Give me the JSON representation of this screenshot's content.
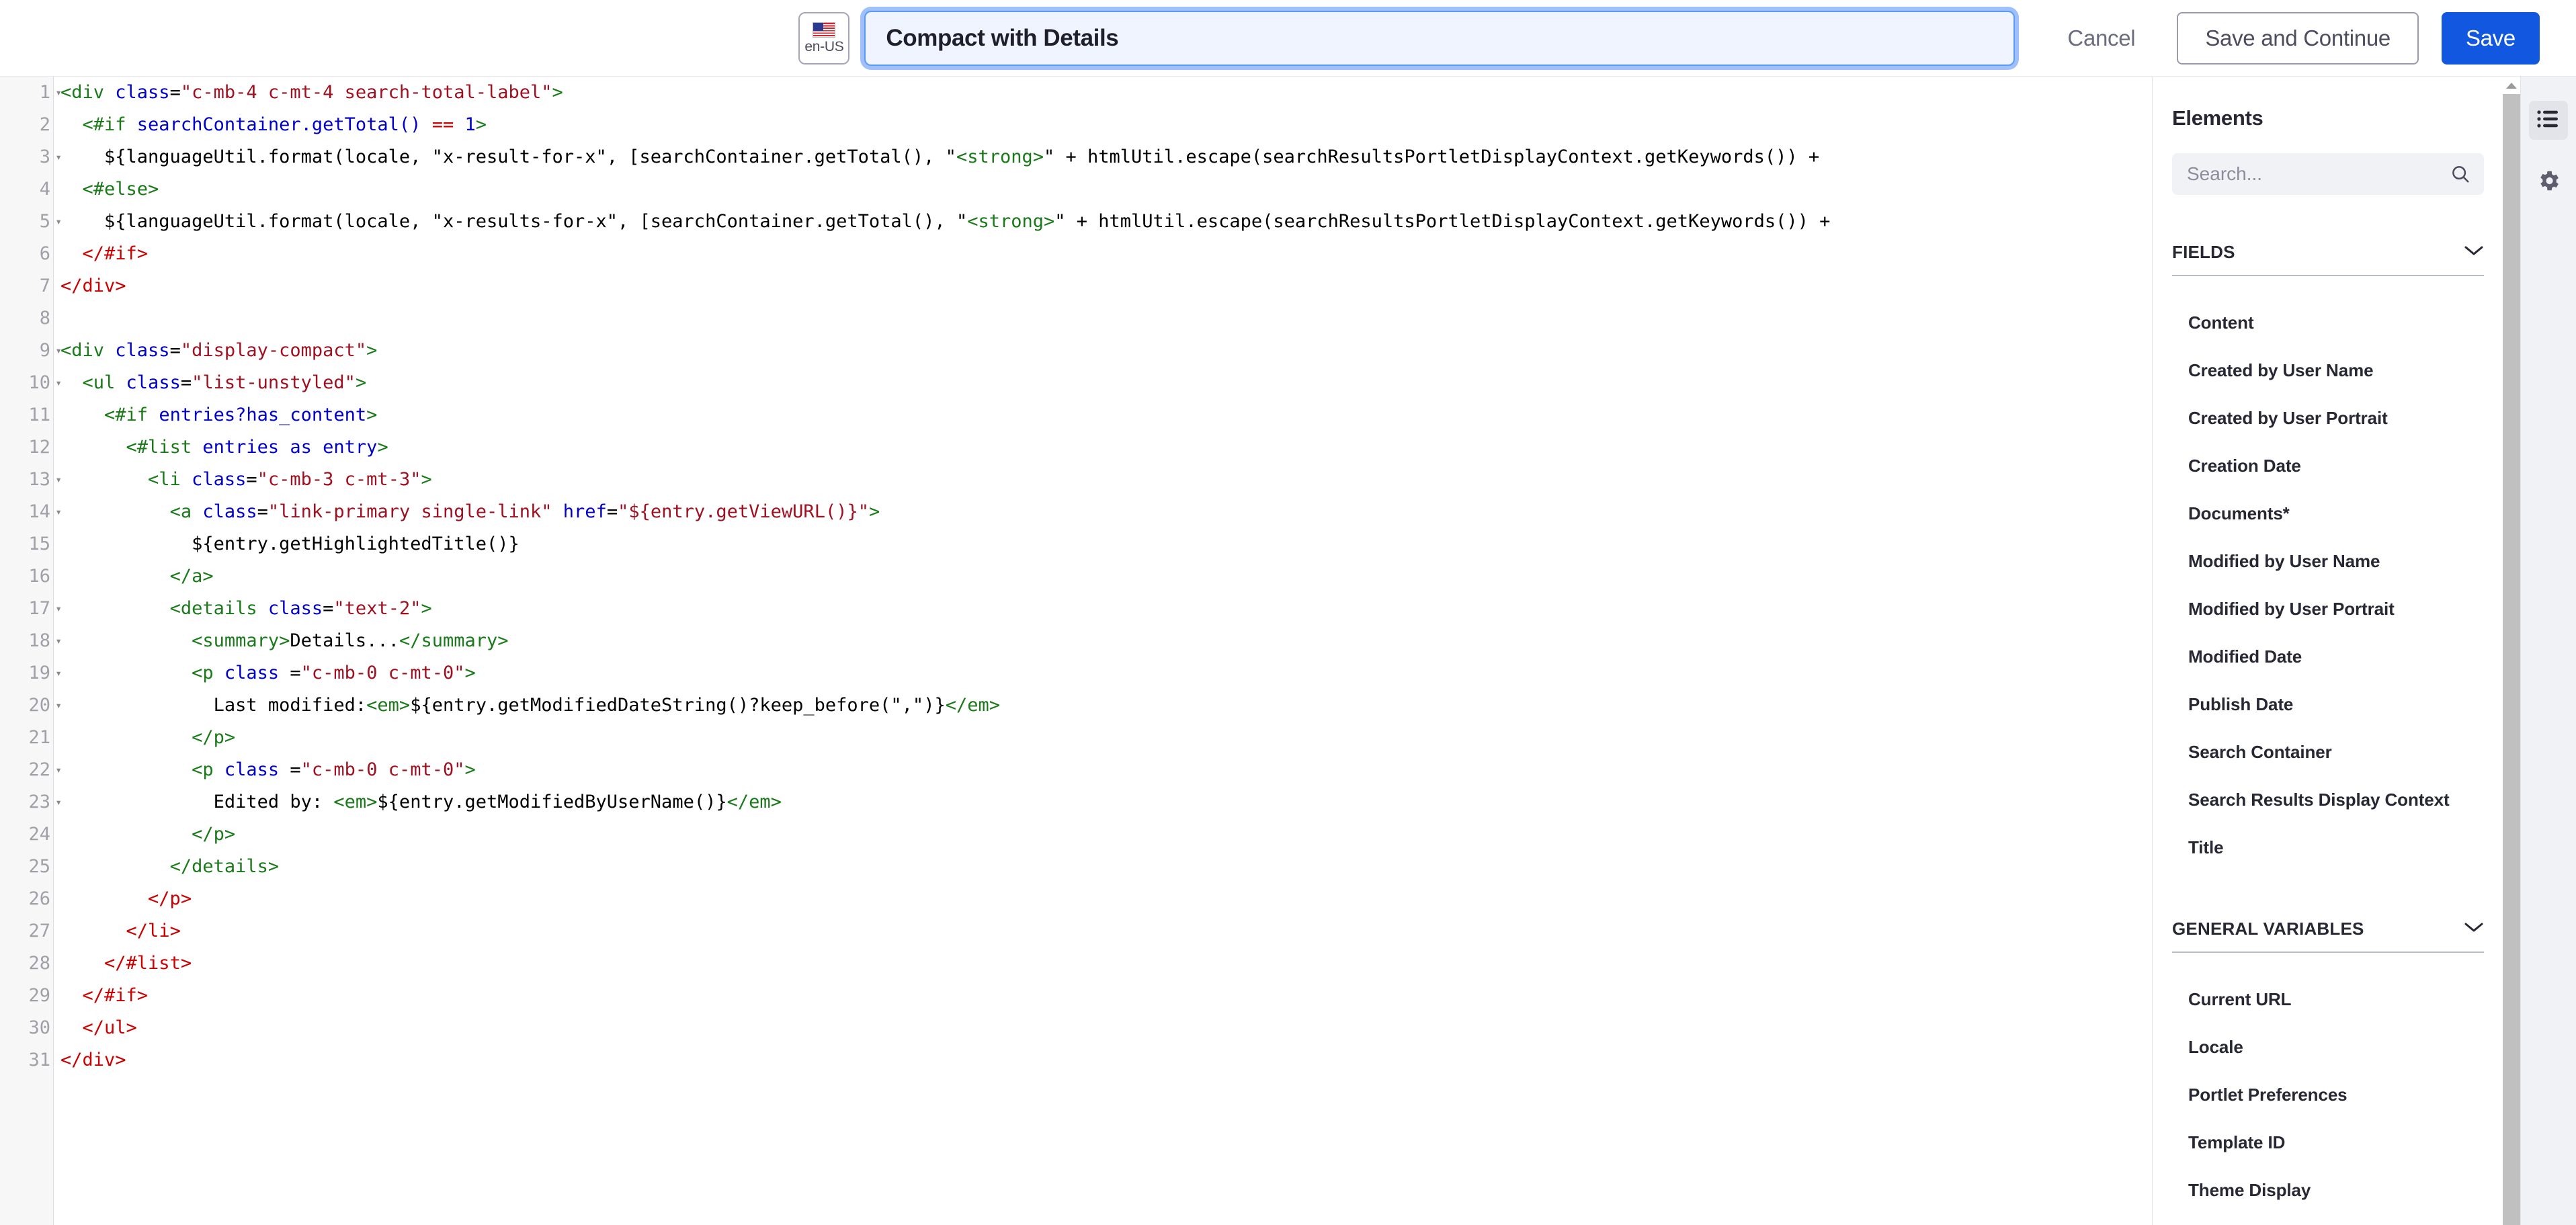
{
  "topbar": {
    "locale": {
      "code": "en-US",
      "flag_icon": "us-flag-icon"
    },
    "title_value": "Compact with Details",
    "title_placeholder": "Untitled Template",
    "cancel_label": "Cancel",
    "save_continue_label": "Save and Continue",
    "save_label": "Save",
    "accent_color": "#1257e0",
    "focus_border_color": "#5a9cf8"
  },
  "editor": {
    "language": "freemarker-html",
    "lines": [
      {
        "n": 1,
        "fold": true,
        "tokens": [
          {
            "t": "tag",
            "s": "<div "
          },
          {
            "t": "attr",
            "s": "class"
          },
          {
            "t": "plain",
            "s": "="
          },
          {
            "t": "str",
            "s": "\"c-mb-4 c-mt-4 search-total-label\""
          },
          {
            "t": "tag",
            "s": ">"
          }
        ]
      },
      {
        "n": 2,
        "fold": false,
        "tokens": [
          {
            "t": "plain",
            "s": "  "
          },
          {
            "t": "tag",
            "s": "<#if "
          },
          {
            "t": "attr",
            "s": "searchContainer.getTotal() "
          },
          {
            "t": "num",
            "s": "=="
          },
          {
            "t": "attr",
            "s": " 1"
          },
          {
            "t": "tag",
            "s": ">"
          }
        ]
      },
      {
        "n": 3,
        "fold": true,
        "tokens": [
          {
            "t": "plain",
            "s": "    ${languageUtil.format(locale, \"x-result-for-x\", [searchContainer.getTotal(), \""
          },
          {
            "t": "tag",
            "s": "<strong>"
          },
          {
            "t": "plain",
            "s": "\" + htmlUtil.escape(searchResultsPortletDisplayContext.getKeywords()) +"
          }
        ]
      },
      {
        "n": 4,
        "fold": false,
        "tokens": [
          {
            "t": "plain",
            "s": "  "
          },
          {
            "t": "tag",
            "s": "<#else>"
          }
        ]
      },
      {
        "n": 5,
        "fold": true,
        "tokens": [
          {
            "t": "plain",
            "s": "    ${languageUtil.format(locale, \"x-results-for-x\", [searchContainer.getTotal(), \""
          },
          {
            "t": "tag",
            "s": "<strong>"
          },
          {
            "t": "plain",
            "s": "\" + htmlUtil.escape(searchResultsPortletDisplayContext.getKeywords()) +"
          }
        ]
      },
      {
        "n": 6,
        "fold": false,
        "tokens": [
          {
            "t": "plain",
            "s": "  "
          },
          {
            "t": "tagr",
            "s": "</#if>"
          }
        ]
      },
      {
        "n": 7,
        "fold": false,
        "tokens": [
          {
            "t": "tagr",
            "s": "</div>"
          }
        ]
      },
      {
        "n": 8,
        "fold": false,
        "tokens": []
      },
      {
        "n": 9,
        "fold": true,
        "tokens": [
          {
            "t": "tag",
            "s": "<div "
          },
          {
            "t": "attr",
            "s": "class"
          },
          {
            "t": "plain",
            "s": "="
          },
          {
            "t": "str",
            "s": "\"display-compact\""
          },
          {
            "t": "tag",
            "s": ">"
          }
        ]
      },
      {
        "n": 10,
        "fold": true,
        "tokens": [
          {
            "t": "plain",
            "s": "  "
          },
          {
            "t": "tag",
            "s": "<ul "
          },
          {
            "t": "attr",
            "s": "class"
          },
          {
            "t": "plain",
            "s": "="
          },
          {
            "t": "str",
            "s": "\"list-unstyled\""
          },
          {
            "t": "tag",
            "s": ">"
          }
        ]
      },
      {
        "n": 11,
        "fold": false,
        "tokens": [
          {
            "t": "plain",
            "s": "    "
          },
          {
            "t": "tag",
            "s": "<#if "
          },
          {
            "t": "attr",
            "s": "entries?has_content"
          },
          {
            "t": "tag",
            "s": ">"
          }
        ]
      },
      {
        "n": 12,
        "fold": false,
        "tokens": [
          {
            "t": "plain",
            "s": "      "
          },
          {
            "t": "tag",
            "s": "<#list "
          },
          {
            "t": "attr",
            "s": "entries as entry"
          },
          {
            "t": "tag",
            "s": ">"
          }
        ]
      },
      {
        "n": 13,
        "fold": true,
        "tokens": [
          {
            "t": "plain",
            "s": "        "
          },
          {
            "t": "tag",
            "s": "<li "
          },
          {
            "t": "attr",
            "s": "class"
          },
          {
            "t": "plain",
            "s": "="
          },
          {
            "t": "str",
            "s": "\"c-mb-3 c-mt-3\""
          },
          {
            "t": "tag",
            "s": ">"
          }
        ]
      },
      {
        "n": 14,
        "fold": true,
        "tokens": [
          {
            "t": "plain",
            "s": "          "
          },
          {
            "t": "tag",
            "s": "<a "
          },
          {
            "t": "attr",
            "s": "class"
          },
          {
            "t": "plain",
            "s": "="
          },
          {
            "t": "str",
            "s": "\"link-primary single-link\" "
          },
          {
            "t": "attr",
            "s": "href"
          },
          {
            "t": "plain",
            "s": "="
          },
          {
            "t": "str",
            "s": "\"${entry.getViewURL()}\""
          },
          {
            "t": "tag",
            "s": ">"
          }
        ]
      },
      {
        "n": 15,
        "fold": false,
        "tokens": [
          {
            "t": "plain",
            "s": "            ${entry.getHighlightedTitle()}"
          }
        ]
      },
      {
        "n": 16,
        "fold": false,
        "tokens": [
          {
            "t": "plain",
            "s": "          "
          },
          {
            "t": "tag",
            "s": "</a>"
          }
        ]
      },
      {
        "n": 17,
        "fold": true,
        "tokens": [
          {
            "t": "plain",
            "s": "          "
          },
          {
            "t": "tag",
            "s": "<details "
          },
          {
            "t": "attr",
            "s": "class"
          },
          {
            "t": "plain",
            "s": "="
          },
          {
            "t": "str",
            "s": "\"text-2\""
          },
          {
            "t": "tag",
            "s": ">"
          }
        ]
      },
      {
        "n": 18,
        "fold": true,
        "tokens": [
          {
            "t": "plain",
            "s": "            "
          },
          {
            "t": "tag",
            "s": "<summary>"
          },
          {
            "t": "plain",
            "s": "Details..."
          },
          {
            "t": "tag",
            "s": "</summary>"
          }
        ]
      },
      {
        "n": 19,
        "fold": true,
        "tokens": [
          {
            "t": "plain",
            "s": "            "
          },
          {
            "t": "tag",
            "s": "<p "
          },
          {
            "t": "attr",
            "s": "class"
          },
          {
            "t": "plain",
            "s": " ="
          },
          {
            "t": "str",
            "s": "\"c-mb-0 c-mt-0\""
          },
          {
            "t": "tag",
            "s": ">"
          }
        ]
      },
      {
        "n": 20,
        "fold": true,
        "tokens": [
          {
            "t": "plain",
            "s": "              Last modified:"
          },
          {
            "t": "tag",
            "s": "<em>"
          },
          {
            "t": "plain",
            "s": "${entry.getModifiedDateString()?keep_before(\",\")}"
          },
          {
            "t": "tag",
            "s": "</em>"
          }
        ]
      },
      {
        "n": 21,
        "fold": false,
        "tokens": [
          {
            "t": "plain",
            "s": "            "
          },
          {
            "t": "tag",
            "s": "</p>"
          }
        ]
      },
      {
        "n": 22,
        "fold": true,
        "tokens": [
          {
            "t": "plain",
            "s": "            "
          },
          {
            "t": "tag",
            "s": "<p "
          },
          {
            "t": "attr",
            "s": "class"
          },
          {
            "t": "plain",
            "s": " ="
          },
          {
            "t": "str",
            "s": "\"c-mb-0 c-mt-0\""
          },
          {
            "t": "tag",
            "s": ">"
          }
        ]
      },
      {
        "n": 23,
        "fold": true,
        "tokens": [
          {
            "t": "plain",
            "s": "              Edited by: "
          },
          {
            "t": "tag",
            "s": "<em>"
          },
          {
            "t": "plain",
            "s": "${entry.getModifiedByUserName()}"
          },
          {
            "t": "tag",
            "s": "</em>"
          }
        ]
      },
      {
        "n": 24,
        "fold": false,
        "tokens": [
          {
            "t": "plain",
            "s": "            "
          },
          {
            "t": "tag",
            "s": "</p>"
          }
        ]
      },
      {
        "n": 25,
        "fold": false,
        "tokens": [
          {
            "t": "plain",
            "s": "          "
          },
          {
            "t": "tag",
            "s": "</details>"
          }
        ]
      },
      {
        "n": 26,
        "fold": false,
        "tokens": [
          {
            "t": "plain",
            "s": "        "
          },
          {
            "t": "tagr",
            "s": "</p>"
          }
        ]
      },
      {
        "n": 27,
        "fold": false,
        "tokens": [
          {
            "t": "plain",
            "s": "      "
          },
          {
            "t": "tagr",
            "s": "</li>"
          }
        ]
      },
      {
        "n": 28,
        "fold": false,
        "tokens": [
          {
            "t": "plain",
            "s": "    "
          },
          {
            "t": "tagr",
            "s": "</#list>"
          }
        ]
      },
      {
        "n": 29,
        "fold": false,
        "tokens": [
          {
            "t": "plain",
            "s": "  "
          },
          {
            "t": "tagr",
            "s": "</#if>"
          }
        ]
      },
      {
        "n": 30,
        "fold": false,
        "tokens": [
          {
            "t": "plain",
            "s": "  "
          },
          {
            "t": "tagr",
            "s": "</ul>"
          }
        ]
      },
      {
        "n": 31,
        "fold": false,
        "tokens": [
          {
            "t": "tagr",
            "s": "</div>"
          }
        ]
      }
    ]
  },
  "panel": {
    "title": "Elements",
    "search_placeholder": "Search...",
    "search_value": "",
    "search_icon": "search-icon",
    "sections": [
      {
        "label": "FIELDS",
        "expanded": true,
        "chevron_icon": "chevron-down-icon",
        "items": [
          "Content",
          "Created by User Name",
          "Created by User Portrait",
          "Creation Date",
          "Documents*",
          "Modified by User Name",
          "Modified by User Portrait",
          "Modified Date",
          "Publish Date",
          "Search Container",
          "Search Results Display Context",
          "Title"
        ]
      },
      {
        "label": "GENERAL VARIABLES",
        "expanded": true,
        "chevron_icon": "chevron-down-icon",
        "items": [
          "Current URL",
          "Locale",
          "Portlet Preferences",
          "Template ID",
          "Theme Display"
        ]
      }
    ]
  },
  "rail": {
    "buttons": [
      {
        "icon": "list-icon",
        "active": true
      },
      {
        "icon": "gear-icon",
        "active": false
      }
    ]
  }
}
